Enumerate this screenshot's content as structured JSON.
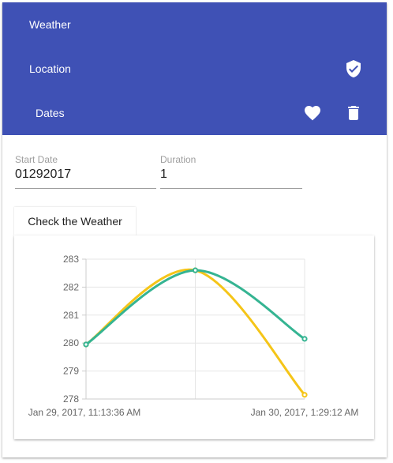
{
  "nav": {
    "weather_label": "Weather",
    "location_label": "Location",
    "dates_label": "Dates",
    "icons": {
      "location": "verified-shield-icon",
      "favorite": "heart-icon",
      "delete": "trash-icon"
    }
  },
  "form": {
    "start_date": {
      "label": "Start Date",
      "value": "01292017"
    },
    "duration": {
      "label": "Duration",
      "value": "1"
    }
  },
  "check_button_label": "Check the Weather",
  "colors": {
    "nav_bg": "#3f51b5",
    "series_yellow": "#f5c518",
    "series_green": "#35b492"
  },
  "chart_data": {
    "type": "line",
    "x_tick_labels": [
      "Jan 29, 2017, 11:13:36 AM",
      "Jan 30, 2017, 1:29:12 AM"
    ],
    "y_ticks": [
      278,
      279,
      280,
      281,
      282,
      283
    ],
    "ylim": [
      278,
      283
    ],
    "grid": true,
    "series": [
      {
        "color": "#f5c518",
        "values": [
          279.95,
          282.6,
          278.15
        ]
      },
      {
        "color": "#35b492",
        "values": [
          279.95,
          282.6,
          280.15
        ]
      }
    ]
  }
}
